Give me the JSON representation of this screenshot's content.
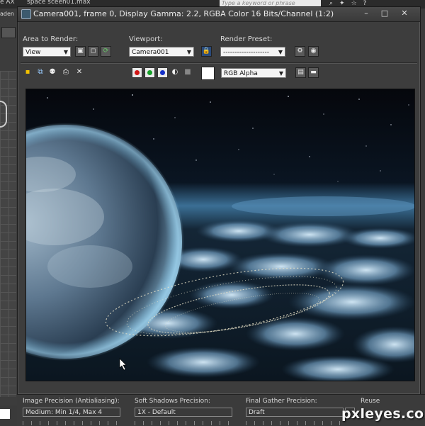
{
  "app": {
    "menu_text": "e AX",
    "file_title": "space sceen01.max",
    "search_placeholder": "Type a keyword or phrase",
    "left_label": "aden"
  },
  "window": {
    "title": "Camera001, frame 0, Display Gamma: 2.2, RGBA Color 16 Bits/Channel (1:2)",
    "minimize": "–",
    "maximize": "□",
    "close": "✕"
  },
  "controls": {
    "area_label": "Area to Render:",
    "area_value": "View",
    "viewport_label": "Viewport:",
    "viewport_value": "Camera001",
    "preset_label": "Render Preset:",
    "preset_value": "--------------------",
    "channel_value": "RGB Alpha"
  },
  "channels": {
    "red": "#d01515",
    "green": "#17a12a",
    "blue": "#1530c8"
  },
  "bottom": {
    "aa_label": "Image Precision (Antialiasing):",
    "aa_value": "Medium: Min 1/4, Max 4",
    "shadows_label": "Soft Shadows Precision:",
    "shadows_value": "1X - Default",
    "fg_label": "Final Gather Precision:",
    "fg_value": "Draft",
    "reuse_label": "Reuse"
  },
  "watermark": "pxleyes.com"
}
